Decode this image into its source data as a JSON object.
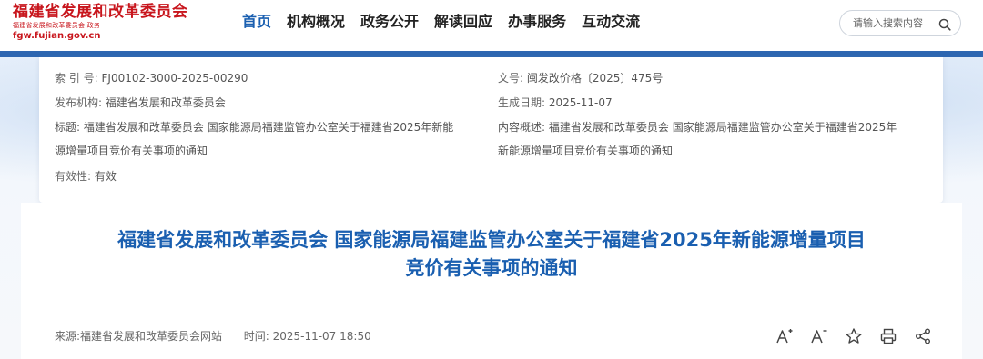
{
  "site": {
    "logo_title": "福建省发展和改革委员会",
    "logo_subtitle": "福建省发展和改革委员会.政务",
    "logo_domain": "fgw.fujian.gov.cn"
  },
  "nav": {
    "items": [
      {
        "label": "首页",
        "active": true
      },
      {
        "label": "机构概况",
        "active": false
      },
      {
        "label": "政务公开",
        "active": false
      },
      {
        "label": "解读回应",
        "active": false
      },
      {
        "label": "办事服务",
        "active": false
      },
      {
        "label": "互动交流",
        "active": false
      }
    ]
  },
  "search": {
    "placeholder": "请输入搜索内容",
    "icon": "search-icon"
  },
  "info": {
    "index_label": "索 引 号:",
    "index_value": "FJ00102-3000-2025-00290",
    "doc_no_label": "文号:",
    "doc_no_value": "闽发改价格〔2025〕475号",
    "publisher_label": "发布机构:",
    "publisher_value": "福建省发展和改革委员会",
    "date_label": "生成日期:",
    "date_value": "2025-11-07",
    "title_label": "标题:",
    "title_line1": "福建省发展和改革委员会 国家能源局福建监管办公室关于福建省2025年新能",
    "title_line2": "源增量项目竞价有关事项的通知",
    "summary_label": "内容概述:",
    "summary_line1": "福建省发展和改革委员会 国家能源局福建监管办公室关于福建省2025年",
    "summary_line2": "新能源增量项目竞价有关事项的通知",
    "validity_label": "有效性:",
    "validity_value": "有效"
  },
  "article": {
    "title_line1": "福建省发展和改革委员会 国家能源局福建监管办公室关于福建省2025年新能源增量项目",
    "title_line2": "竞价有关事项的通知",
    "source": "来源:福建省发展和改革委员会网站",
    "time_label": "时间:",
    "time_value": "2025-11-07 18:50"
  },
  "colors": {
    "brand_red": "#c8161d",
    "primary_blue": "#1a5fb0",
    "header_bar": "#2d66b1"
  },
  "tools": [
    "font-increase-icon",
    "font-decrease-icon",
    "star-icon",
    "print-icon",
    "share-icon"
  ]
}
